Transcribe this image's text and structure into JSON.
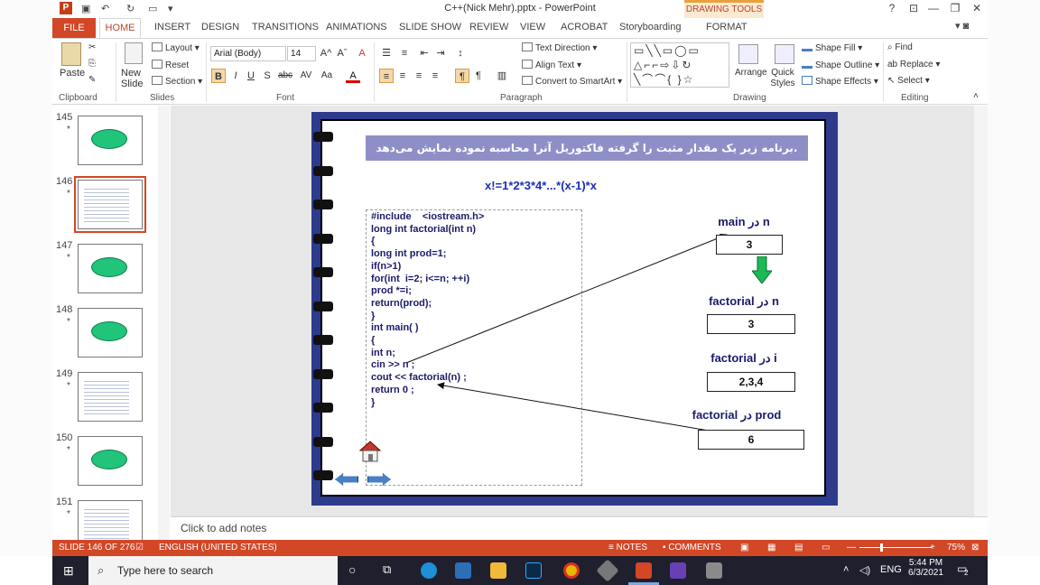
{
  "window": {
    "title": "C++(Nick Mehr).pptx - PowerPoint",
    "contextual_tab": "DRAWING TOOLS",
    "help": "?",
    "minimize": "—",
    "restore": "❐",
    "close": "✕"
  },
  "tabs": [
    "FILE",
    "HOME",
    "INSERT",
    "DESIGN",
    "TRANSITIONS",
    "ANIMATIONS",
    "SLIDE SHOW",
    "REVIEW",
    "VIEW",
    "ACROBAT",
    "Storyboarding",
    "FORMAT"
  ],
  "ribbon": {
    "clipboard": {
      "paste": "Paste",
      "label": "Clipboard"
    },
    "slides": {
      "new_slide": "New Slide",
      "layout": "Layout",
      "reset": "Reset",
      "section": "Section",
      "label": "Slides"
    },
    "font": {
      "name": "Arial (Body)",
      "size": "14",
      "bold": "B",
      "italic": "I",
      "underline": "U",
      "strike": "S",
      "abc": "abc",
      "spacing": "AV",
      "case": "Aa",
      "color": "A",
      "grow": "A^",
      "shrink": "Aˇ",
      "clear": "A",
      "label": "Font"
    },
    "paragraph": {
      "text_direction": "Text Direction",
      "align_text": "Align Text",
      "convert": "Convert to SmartArt",
      "label": "Paragraph"
    },
    "drawing": {
      "arrange": "Arrange",
      "quick_styles": "Quick Styles",
      "shape_fill": "Shape Fill",
      "shape_outline": "Shape Outline",
      "shape_effects": "Shape Effects",
      "label": "Drawing"
    },
    "editing": {
      "find": "Find",
      "replace": "Replace",
      "select": "Select",
      "label": "Editing"
    }
  },
  "thumbnails": [
    {
      "num": "145",
      "star": "*",
      "kind": "blob"
    },
    {
      "num": "146",
      "star": "*",
      "kind": "code",
      "selected": true
    },
    {
      "num": "147",
      "star": "*",
      "kind": "blob"
    },
    {
      "num": "148",
      "star": "*",
      "kind": "blob"
    },
    {
      "num": "149",
      "star": "*",
      "kind": "code"
    },
    {
      "num": "150",
      "star": "*",
      "kind": "blob"
    },
    {
      "num": "151",
      "star": "*",
      "kind": "code"
    }
  ],
  "slide": {
    "banner": "برنامه زیر یک مقدار مثبت را گرفته فاکتوریل آنرا محاسبه نموده نمایش می‌دهد.",
    "formula": "x!=1*2*3*4*...*(x-1)*x",
    "code_lines": [
      "#include    <iostream.h>",
      "long int factorial(int n)",
      "{",
      "long int prod=1;",
      "if(n>1)",
      "for(int  i=2; i<=n; ++i)",
      "prod *=i;",
      "return(prod);",
      "}",
      "int main( )",
      "{",
      "int n;",
      "cin >> n ;",
      "cout << factorial(n) ;",
      "return 0 ;",
      "}"
    ],
    "vars": [
      {
        "label": "main در n",
        "value": "3"
      },
      {
        "label": "factorial در n",
        "value": "3"
      },
      {
        "label": "factorial در i",
        "value": "2,3,4"
      },
      {
        "label": "factorial در prod",
        "value": "6"
      }
    ]
  },
  "notes": {
    "placeholder": "Click to add notes"
  },
  "status": {
    "slide": "SLIDE 146 OF 276",
    "language": "ENGLISH (UNITED STATES)",
    "notes": "NOTES",
    "comments": "COMMENTS",
    "zoom": "75%"
  },
  "taskbar": {
    "search_placeholder": "Type here to search",
    "lang": "ENG",
    "time": "5:44 PM",
    "date": "6/3/2021",
    "notifications": "2"
  }
}
